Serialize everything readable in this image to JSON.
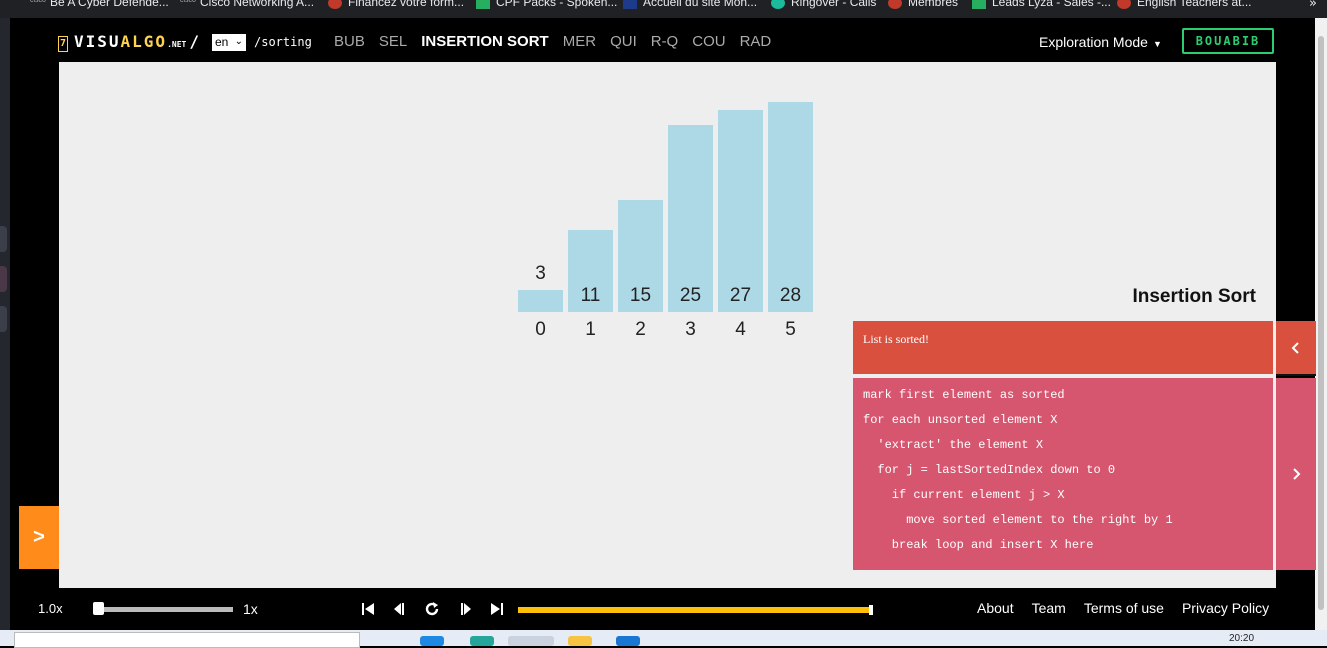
{
  "browser": {
    "bookmarks": [
      {
        "label": "Be A Cyber Defende...",
        "icon": "cisco-icon"
      },
      {
        "label": "Cisco Networking A...",
        "icon": "cisco-icon"
      },
      {
        "label": "Financez votre form...",
        "icon": "flag-uk-icon"
      },
      {
        "label": "CPF Packs - Spoken...",
        "icon": "green-plus-icon"
      },
      {
        "label": "Accueil du site Mon...",
        "icon": "site-icon"
      },
      {
        "label": "Ringover - Calls",
        "icon": "ringover-icon"
      },
      {
        "label": "Membres",
        "icon": "flag-uk-icon"
      },
      {
        "label": "Leads Lyza - Sales -...",
        "icon": "green-plus-icon"
      },
      {
        "label": "English Teachers at...",
        "icon": "flag-uk-icon"
      }
    ],
    "more_label": "»"
  },
  "header": {
    "logo_num": "7",
    "logo_white": "VISU",
    "logo_yellow": "ALGO",
    "logo_net": ".NET",
    "logo_slash": "/",
    "lang_value": "en",
    "path": "/sorting",
    "algorithms": [
      "BUB",
      "SEL",
      "INSERTION SORT",
      "MER",
      "QUI",
      "R-Q",
      "COU",
      "RAD"
    ],
    "active_algorithm": "INSERTION SORT",
    "mode_label": "Exploration Mode",
    "login_label": "BOUABIB"
  },
  "visualization": {
    "values": [
      3,
      11,
      15,
      25,
      27,
      28
    ],
    "indices": [
      "0",
      "1",
      "2",
      "3",
      "4",
      "5"
    ],
    "bar_color": "#add8e6"
  },
  "panel": {
    "title": "Insertion Sort",
    "status": "List is sorted!",
    "code_lines": [
      "mark first element as sorted",
      "for each unsorted element X",
      "  'extract' the element X",
      "  for j = lastSortedIndex down to 0",
      "    if current element j > X",
      "      move sorted element to the right by 1",
      "    break loop and insert X here"
    ],
    "status_color": "#d9503f",
    "code_color": "#d6566f",
    "left_toggle_label": ">"
  },
  "controls": {
    "speed_value": "1.0x",
    "speed_max": "1x",
    "speed_fraction": 0.0,
    "progress_fraction": 1.0,
    "media_buttons": [
      "skip-start-icon",
      "step-back-icon",
      "replay-icon",
      "step-forward-icon",
      "skip-end-icon"
    ],
    "links": [
      "About",
      "Team",
      "Terms of use",
      "Privacy Policy"
    ],
    "accent": "#ffc107"
  },
  "taskbar": {
    "time": "20:20"
  }
}
